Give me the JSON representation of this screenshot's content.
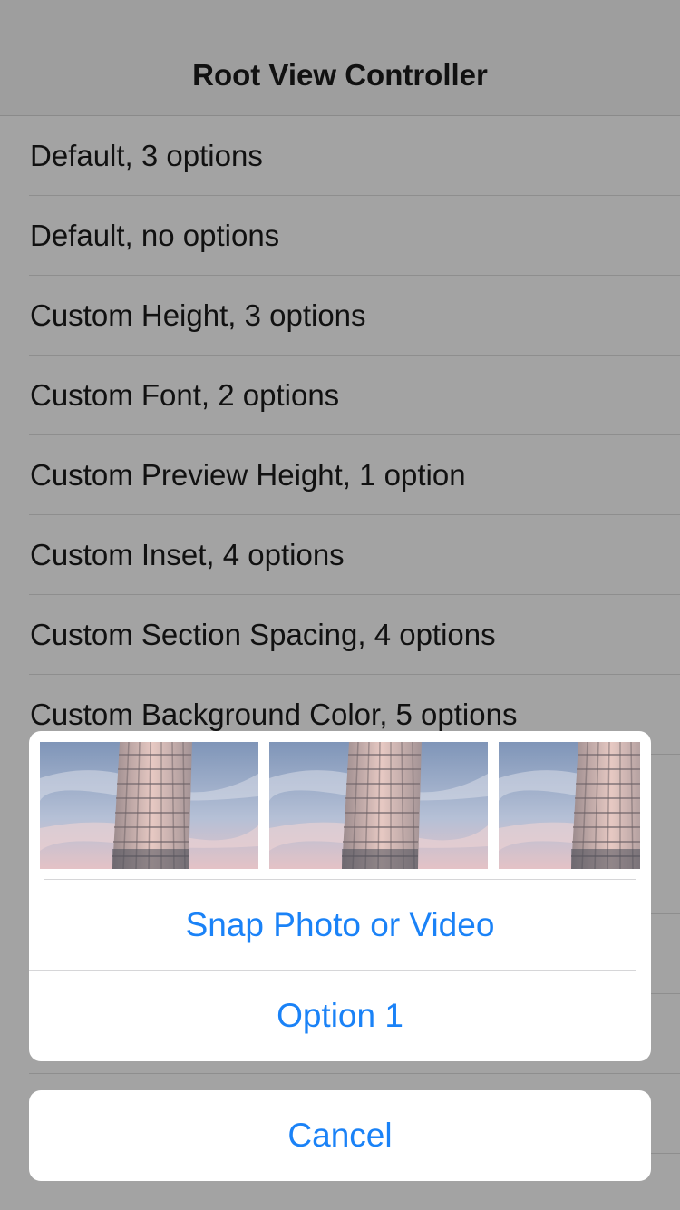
{
  "navbar": {
    "title": "Root View Controller"
  },
  "list": {
    "items": [
      {
        "label": "Default, 3 options"
      },
      {
        "label": "Default, no options"
      },
      {
        "label": "Custom Height, 3 options"
      },
      {
        "label": "Custom Font, 2 options"
      },
      {
        "label": "Custom Preview Height, 1 option"
      },
      {
        "label": "Custom Inset, 4 options"
      },
      {
        "label": "Custom Section Spacing, 4 options"
      },
      {
        "label": "Custom Background Color, 5 options"
      }
    ]
  },
  "sheet": {
    "preview_count_visible": 3,
    "actions": [
      {
        "label": "Snap Photo or Video"
      },
      {
        "label": "Option 1"
      }
    ],
    "cancel_label": "Cancel"
  },
  "colors": {
    "dimmed_background": "#a3a3a3",
    "action_tint": "#1a82f7",
    "sheet_background": "#ffffff"
  }
}
